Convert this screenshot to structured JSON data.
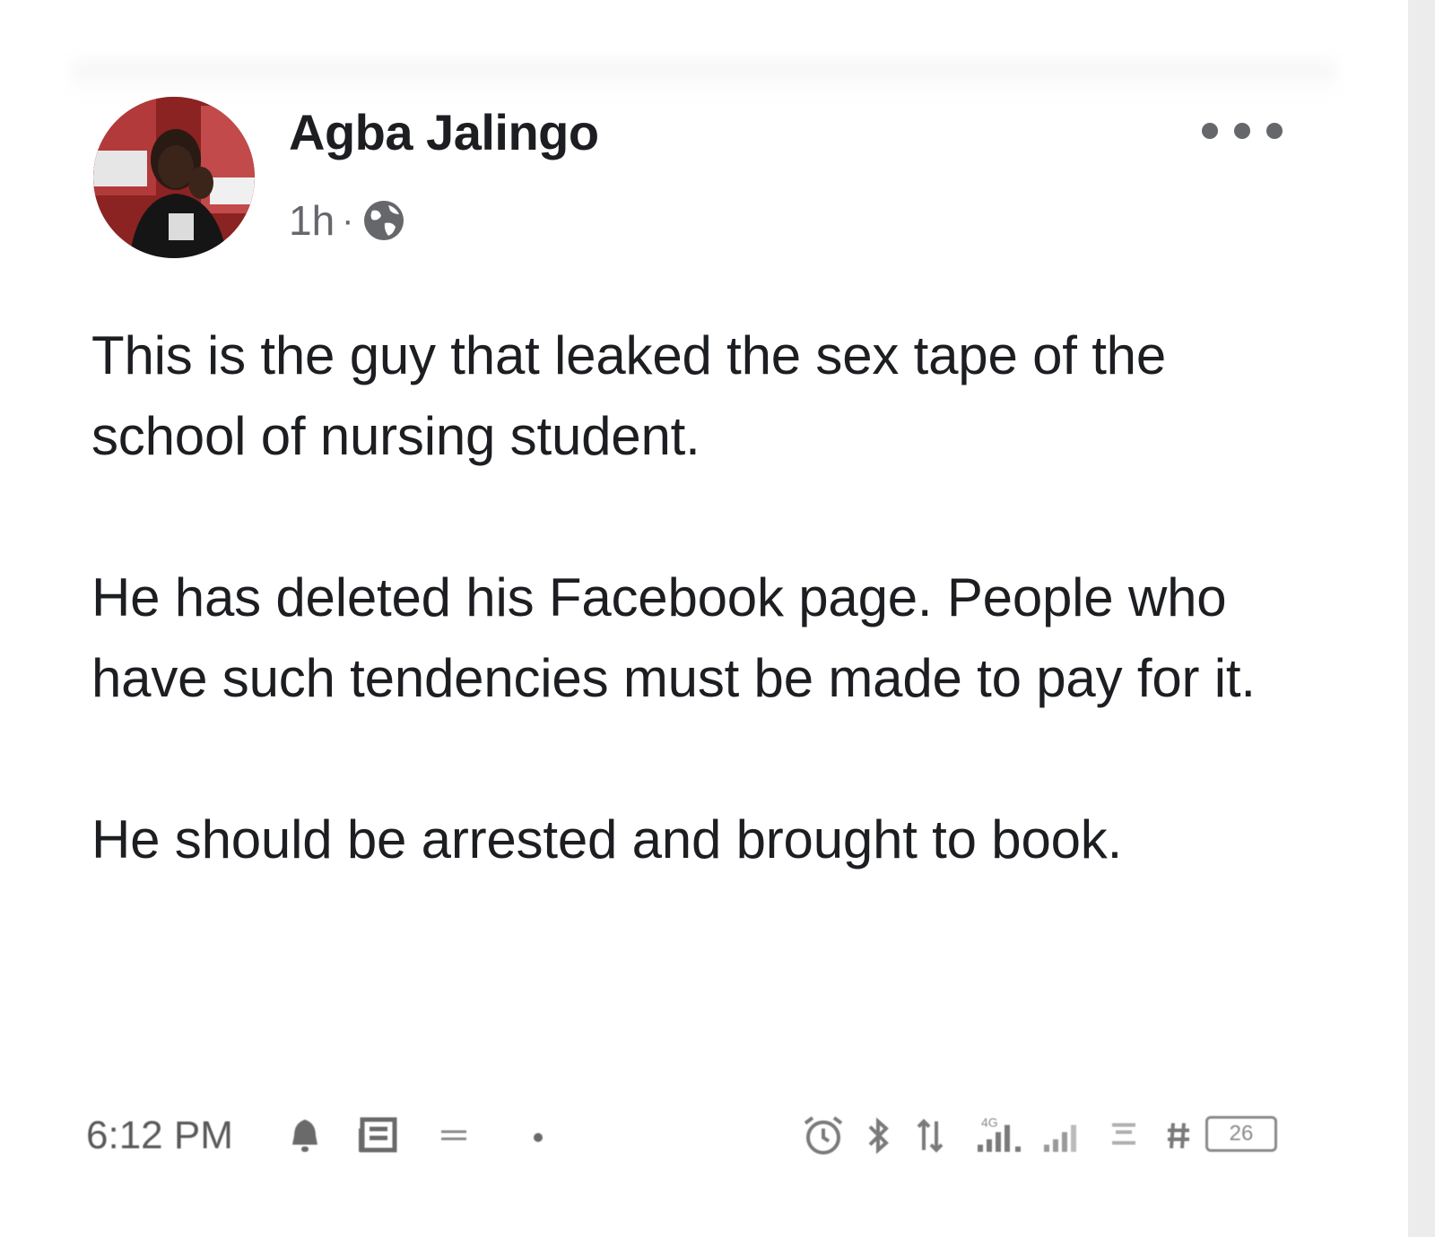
{
  "post": {
    "author": "Agba Jalingo",
    "time": "1h",
    "separator": "·",
    "privacy_icon": "globe-icon",
    "more_icon": "more-options-icon",
    "paragraphs": [
      "This is the guy that leaked the sex tape of the school of nursing student.",
      "He has deleted his Facebook page. People who have such tendencies must be made to pay for it.",
      "He should be arrested and brought to book."
    ]
  },
  "status_bar": {
    "time": "6:12 PM",
    "left_icons": [
      "notification-bell-icon",
      "news-icon",
      "cast-icon",
      "dot-icon"
    ],
    "right_icons": [
      "alarm-icon",
      "bluetooth-icon",
      "data-arrows-icon",
      "signal-4g-icon",
      "signal-icon",
      "network-speed-icon",
      "hotspot-icon"
    ],
    "battery_level": "26"
  },
  "colors": {
    "text": "#1c1e21",
    "secondary": "#65676b",
    "background": "#ffffff"
  }
}
